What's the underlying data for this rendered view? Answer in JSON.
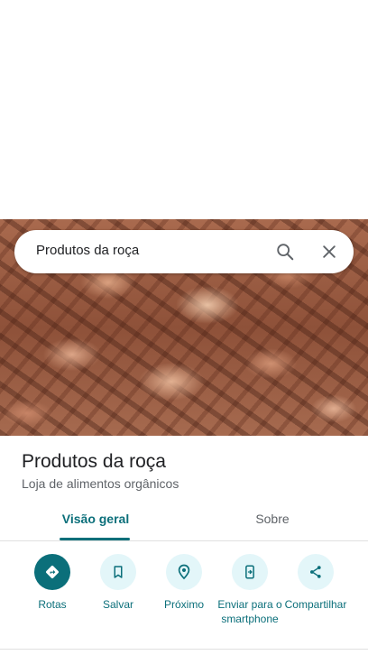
{
  "search": {
    "query": "Produtos da roça"
  },
  "place": {
    "name": "Produtos da roça",
    "category": "Loja de alimentos orgânicos"
  },
  "tabs": [
    {
      "label": "Visão geral",
      "selected": true
    },
    {
      "label": "Sobre",
      "selected": false
    }
  ],
  "actions": [
    {
      "label": "Rotas",
      "icon": "directions-icon"
    },
    {
      "label": "Salvar",
      "icon": "bookmark-icon"
    },
    {
      "label": "Próximo",
      "icon": "nearby-icon"
    },
    {
      "label": "Enviar para o smartphone",
      "icon": "send-to-phone-icon"
    },
    {
      "label": "Compartilhar",
      "icon": "share-icon"
    }
  ],
  "colors": {
    "accent": "#0b6f7a",
    "action_bg": "#e3f6f9"
  }
}
